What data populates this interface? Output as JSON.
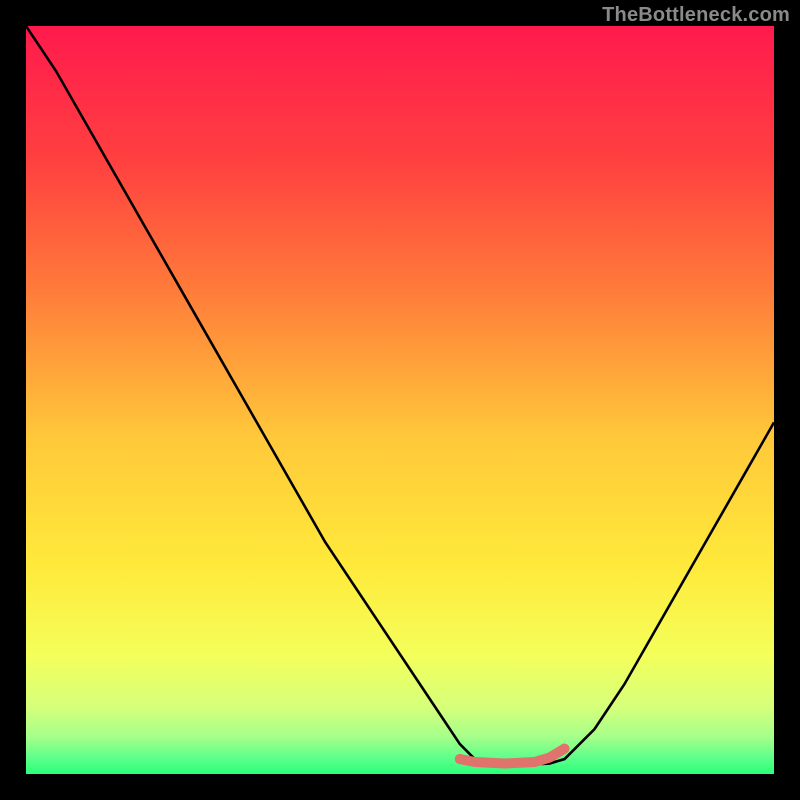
{
  "watermark": "TheBottleneck.com",
  "chart_data": {
    "type": "line",
    "title": "",
    "xlabel": "",
    "ylabel": "",
    "xlim": [
      0,
      100
    ],
    "ylim": [
      0,
      100
    ],
    "gradient": {
      "direction": "vertical",
      "stops": [
        {
          "offset": 0,
          "color": "#ff1a4d"
        },
        {
          "offset": 18,
          "color": "#ff4040"
        },
        {
          "offset": 35,
          "color": "#ff7a3a"
        },
        {
          "offset": 55,
          "color": "#ffc83a"
        },
        {
          "offset": 72,
          "color": "#ffe93a"
        },
        {
          "offset": 84,
          "color": "#f4ff5a"
        },
        {
          "offset": 91,
          "color": "#d6ff7a"
        },
        {
          "offset": 95,
          "color": "#a6ff8a"
        },
        {
          "offset": 98,
          "color": "#5aff8a"
        },
        {
          "offset": 100,
          "color": "#2aff7a"
        }
      ]
    },
    "series": [
      {
        "name": "bottleneck-curve",
        "color": "#000000",
        "stroke_width": 2.6,
        "x": [
          0,
          4,
          8,
          12,
          16,
          20,
          24,
          28,
          32,
          36,
          40,
          44,
          48,
          52,
          56,
          58,
          60,
          62,
          66,
          70,
          72,
          76,
          80,
          84,
          88,
          92,
          96,
          100
        ],
        "y": [
          100,
          94,
          87,
          80,
          73,
          66,
          59,
          52,
          45,
          38,
          31,
          25,
          19,
          13,
          7,
          4,
          2,
          1.4,
          1.2,
          1.4,
          2,
          6,
          12,
          19,
          26,
          33,
          40,
          47
        ]
      },
      {
        "name": "optimal-zone-marker",
        "color": "#e0736b",
        "stroke_width": 10,
        "linecap": "round",
        "x": [
          58,
          60,
          64,
          68,
          70,
          72
        ],
        "y": [
          2.0,
          1.6,
          1.4,
          1.6,
          2.2,
          3.4
        ]
      }
    ],
    "annotations": [
      {
        "type": "dot",
        "x": 58,
        "y": 2.0,
        "r": 5,
        "color": "#e0736b"
      }
    ]
  }
}
